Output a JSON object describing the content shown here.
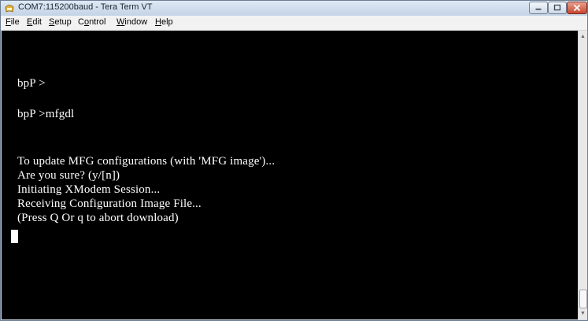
{
  "window": {
    "title": "COM7:115200baud - Tera Term VT",
    "icon": "tera-term-icon",
    "controls": [
      "minimize-icon",
      "maximize-icon",
      "close-icon"
    ]
  },
  "menu": [
    {
      "label": "File",
      "accel": "F",
      "rest": "ile"
    },
    {
      "label": "Edit",
      "accel": "E",
      "rest": "dit"
    },
    {
      "label": "Setup",
      "accel": "S",
      "rest": "etup"
    },
    {
      "label": "Control",
      "accel": "o",
      "pre": "C",
      "rest": "ntrol"
    },
    {
      "label": "Window",
      "accel": "W",
      "rest": "indow"
    },
    {
      "label": "Help",
      "accel": "H",
      "rest": "elp"
    }
  ],
  "terminal": {
    "lines": [
      "bpP >",
      "bpP >mfgdl",
      "To update MFG configurations (with 'MFG image')...",
      "Are you sure? (y/[n])",
      "Initiating XModem Session...",
      "Receiving Configuration Image File...",
      "(Press Q Or q to abort download)"
    ]
  },
  "colors": {
    "terminal_bg": "#000000",
    "terminal_fg": "#ffffff",
    "titlebar": "#cfdbe9",
    "close_button": "#c7452f"
  }
}
